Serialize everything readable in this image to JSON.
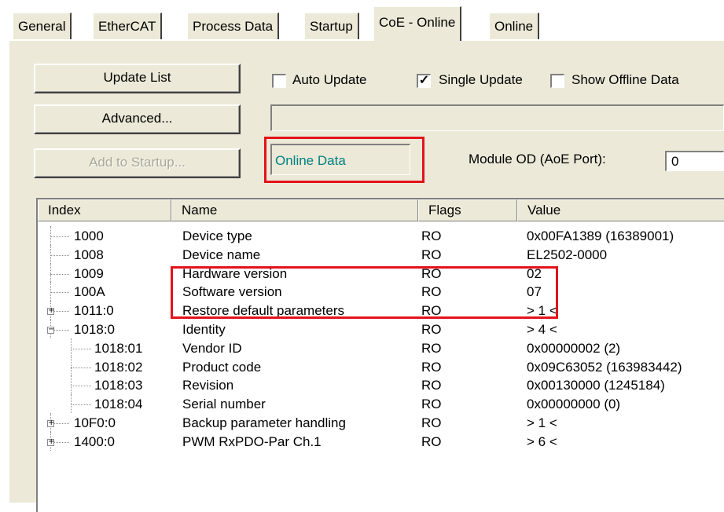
{
  "tabs": [
    {
      "label": "General",
      "active": false
    },
    {
      "label": "EtherCAT",
      "active": false
    },
    {
      "label": "Process Data",
      "active": false
    },
    {
      "label": "Startup",
      "active": false
    },
    {
      "label": "CoE - Online",
      "active": true
    },
    {
      "label": "Online",
      "active": false
    }
  ],
  "buttons": {
    "update_list": "Update List",
    "advanced": "Advanced...",
    "add_to_startup": "Add to Startup..."
  },
  "checkboxes": {
    "auto_update": {
      "label": "Auto Update",
      "checked": false
    },
    "single_update": {
      "label": "Single Update",
      "checked": true
    },
    "show_offline": {
      "label": "Show Offline Data",
      "checked": false
    }
  },
  "status": {
    "online_data": "Online Data",
    "online_data_color": "#008080",
    "module_od_label": "Module OD (AoE Port):",
    "module_od_value": "0"
  },
  "table": {
    "columns": [
      "Index",
      "Name",
      "Flags",
      "Value"
    ],
    "rows": [
      {
        "index": "1000",
        "name": "Device type",
        "flags": "RO",
        "value": "0x00FA1389 (16389001)",
        "level": 0,
        "expander": ""
      },
      {
        "index": "1008",
        "name": "Device name",
        "flags": "RO",
        "value": "EL2502-0000",
        "level": 0,
        "expander": ""
      },
      {
        "index": "1009",
        "name": "Hardware version",
        "flags": "RO",
        "value": "02",
        "level": 0,
        "expander": ""
      },
      {
        "index": "100A",
        "name": "Software version",
        "flags": "RO",
        "value": "07",
        "level": 0,
        "expander": ""
      },
      {
        "index": "1011:0",
        "name": "Restore default parameters",
        "flags": "RO",
        "value": "> 1 <",
        "level": 0,
        "expander": "+"
      },
      {
        "index": "1018:0",
        "name": "Identity",
        "flags": "RO",
        "value": "> 4 <",
        "level": 0,
        "expander": "−"
      },
      {
        "index": "1018:01",
        "name": "Vendor ID",
        "flags": "RO",
        "value": "0x00000002 (2)",
        "level": 1,
        "expander": ""
      },
      {
        "index": "1018:02",
        "name": "Product code",
        "flags": "RO",
        "value": "0x09C63052 (163983442)",
        "level": 1,
        "expander": ""
      },
      {
        "index": "1018:03",
        "name": "Revision",
        "flags": "RO",
        "value": "0x00130000 (1245184)",
        "level": 1,
        "expander": ""
      },
      {
        "index": "1018:04",
        "name": "Serial number",
        "flags": "RO",
        "value": "0x00000000 (0)",
        "level": 1,
        "expander": ""
      },
      {
        "index": "10F0:0",
        "name": "Backup parameter handling",
        "flags": "RO",
        "value": "> 1 <",
        "level": 0,
        "expander": "+"
      },
      {
        "index": "1400:0",
        "name": "PWM RxPDO-Par Ch.1",
        "flags": "RO",
        "value": "> 6 <",
        "level": 0,
        "expander": "+"
      }
    ]
  },
  "colors": {
    "highlight_red": "#e3131a",
    "dialog_bg": "#ece9d8"
  }
}
